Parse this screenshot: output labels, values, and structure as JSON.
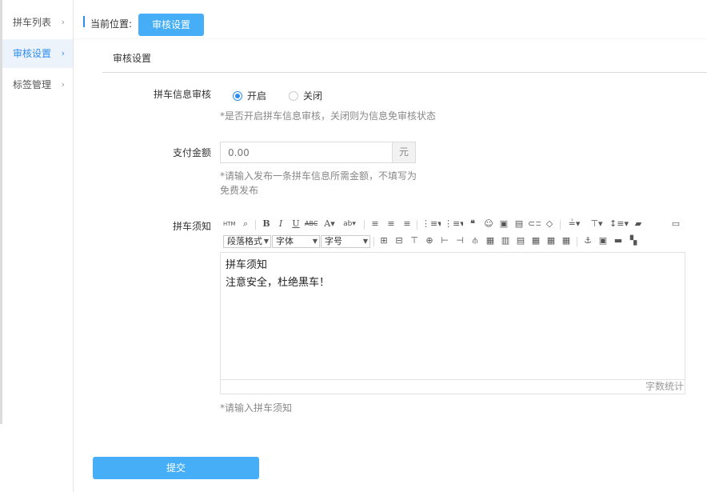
{
  "sidebar": {
    "items": [
      {
        "label": "拼车列表",
        "chevron": "›",
        "active": false
      },
      {
        "label": "审核设置",
        "chevron": "›",
        "active": true
      },
      {
        "label": "标签管理",
        "chevron": "›",
        "active": false
      }
    ]
  },
  "breadcrumb": {
    "prefix": "当前位置:",
    "current": "审核设置"
  },
  "section": {
    "title": "审核设置"
  },
  "form": {
    "review": {
      "label": "拼车信息审核",
      "options": [
        "开启",
        "关闭"
      ],
      "selected": "开启",
      "hint": "*是否开启拼车信息审核，关闭则为信息免审核状态"
    },
    "payment": {
      "label": "支付金额",
      "placeholder": "0.00",
      "unit": "元",
      "hint_line1": "*请输入发布一条拼车信息所需金额，不填写为",
      "hint_line2": "免费发布"
    },
    "notice": {
      "label": "拼车须知",
      "content": [
        "拼车须知",
        "注意安全，杜绝黑车！"
      ],
      "word_count_label": "字数统计",
      "hint": "*请输入拼车须知"
    }
  },
  "editor_toolbar": {
    "paragraph_format": "段落格式",
    "font_family": "字体",
    "font_size": "字号",
    "icons": [
      "source-icon",
      "find-icon",
      "bold-icon",
      "italic-icon",
      "underline-icon",
      "strikethrough-icon",
      "font-color-icon",
      "highlight-icon",
      "align-left-icon",
      "align-center-icon",
      "align-right-icon",
      "ordered-list-icon",
      "unordered-list-icon",
      "blockquote-icon",
      "emoji-icon",
      "image-icon",
      "video-icon",
      "link-icon",
      "eraser-icon",
      "line-height-icon",
      "paragraph-spacing-icon",
      "indent-icon",
      "fullscreen-icon",
      "table-icons",
      "anchor-icon",
      "insert-media-icon",
      "print-icon",
      "preview-icon"
    ]
  },
  "submit": {
    "label": "提交"
  },
  "colors": {
    "accent": "#2d8cf0",
    "button": "#45aef7",
    "active_bg": "#edf3fb"
  }
}
